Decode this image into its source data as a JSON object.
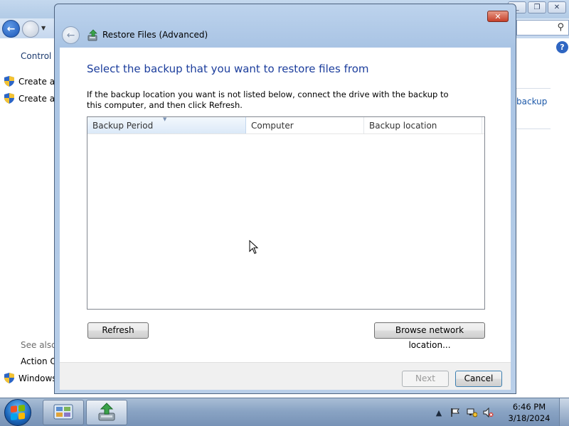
{
  "background_window": {
    "caption_minimize": "_",
    "caption_maximize": "❐",
    "caption_close": "✕",
    "left_nav_title": "Control P",
    "left_links": [
      "Create a",
      "Create a"
    ],
    "see_also_label": "See also",
    "see_also_links": [
      "Action C",
      "Windows"
    ],
    "right_link": "backup",
    "search_icon": "search-icon",
    "help_icon": "?"
  },
  "dialog": {
    "title": "Restore Files (Advanced)",
    "close_icon": "✕",
    "heading": "Select the backup that you want to restore files from",
    "instructions": "If the backup location you want is not listed below, connect the drive with the backup to this computer, and then click Refresh.",
    "list": {
      "columns": [
        "Backup Period",
        "Computer",
        "Backup location"
      ],
      "rows": []
    },
    "refresh_label": "Refresh",
    "browse_label": "Browse network location...",
    "next_label": "Next",
    "cancel_label": "Cancel"
  },
  "taskbar": {
    "start_icon": "windows-start-icon",
    "apps": [
      "control-panel-icon",
      "backup-restore-icon"
    ],
    "tray_icons": [
      "show-hidden-icons",
      "action-center-flag-icon",
      "network-icon",
      "volume-muted-icon"
    ],
    "time": "6:46 PM",
    "date": "3/18/2024"
  },
  "colors": {
    "heading_blue": "#1b3d9c",
    "link_blue": "#1a57a8",
    "dialog_frame": "#a9c4e4"
  }
}
